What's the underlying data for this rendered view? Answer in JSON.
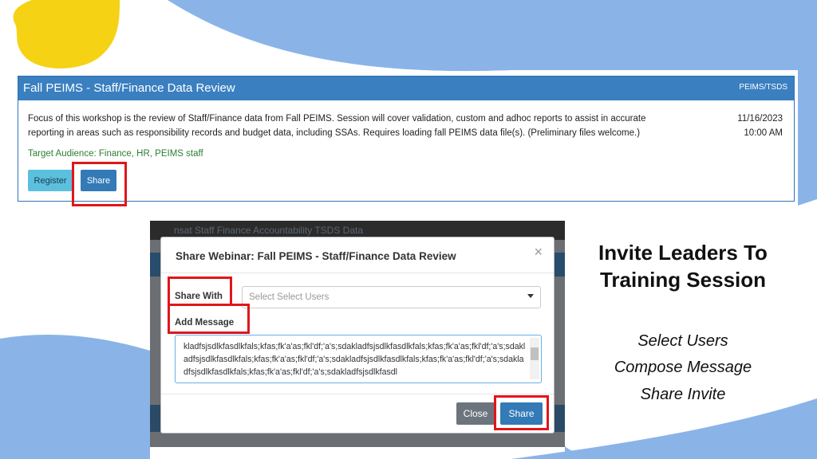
{
  "colors": {
    "yellow": "#f5d214",
    "blue_bg": "#8ab4e8",
    "header_blue": "#3a7fc0",
    "highlight": "#e0161b"
  },
  "card": {
    "title": "Fall PEIMS - Staff/Finance Data Review",
    "tag": "PEIMS/TSDS",
    "description": "Focus of this workshop is the review of Staff/Finance data from Fall PEIMS. Session will cover validation, custom and adhoc reports to assist in accurate reporting in areas such as responsibility records and budget data, including SSAs. Requires loading fall PEIMS data file(s). (Preliminary files welcome.)",
    "date": "11/16/2023",
    "time": "10:00 AM",
    "audience": "Target Audience: Finance, HR, PEIMS staff",
    "register_label": "Register",
    "share_label": "Share"
  },
  "screenshot": {
    "background_text": "nsat   Staff Finance  Accountability   TSDS Data"
  },
  "modal": {
    "title": "Share Webinar: Fall PEIMS - Staff/Finance Data Review",
    "close_glyph": "×",
    "share_with_label": "Share With",
    "select_placeholder": "Select Select Users",
    "add_message_label": "Add Message",
    "message_text": "kladfsjsdlkfasdlkfals;kfas;fk'a'as;fkl'df;'a's;sdakladfsjsdlkfasdlkfals;kfas;fk'a'as;fkl'df;'a's;sdakladfsjsdlkfasdlkfals;kfas;fk'a'as;fkl'df;'a's;sdakladfsjsdlkfasdlkfals;kfas;fk'a'as;fkl'df;'a's;sdakladfsjsdlkfasdlkfals;kfas;fk'a'as;fkl'df;'a's;sdakladfsjsdlkfasdl",
    "close_label": "Close",
    "share_label": "Share"
  },
  "right_panel": {
    "title_line1": "Invite Leaders To",
    "title_line2": "Training Session",
    "steps": [
      "Select Users",
      "Compose Message",
      "Share Invite"
    ]
  }
}
